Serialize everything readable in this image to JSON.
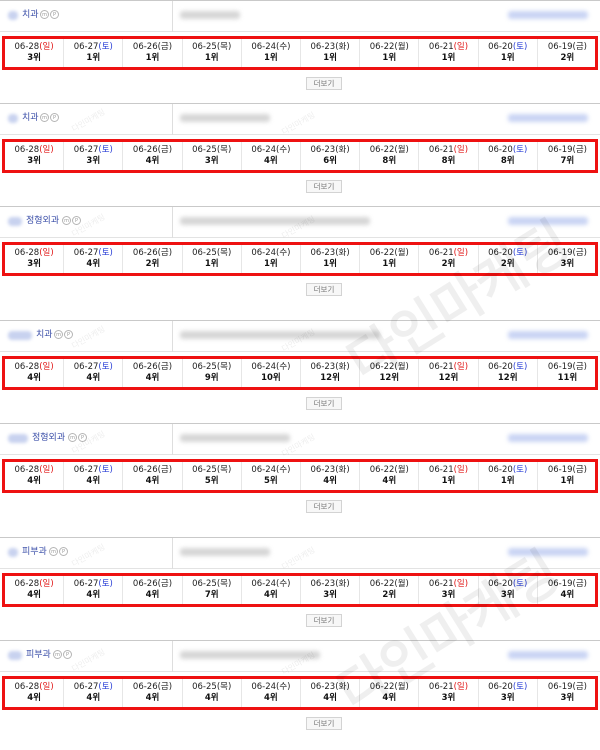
{
  "more_label": "더보기",
  "watermark": "다인마케팅",
  "blocks": [
    {
      "category": "치과",
      "dates": [
        "06-28",
        "06-27",
        "06-26",
        "06-25",
        "06-24",
        "06-23",
        "06-22",
        "06-21",
        "06-20",
        "06-19"
      ],
      "days": [
        "(일)",
        "(토)",
        "(금)",
        "(목)",
        "(수)",
        "(화)",
        "(월)",
        "(일)",
        "(토)",
        "(금)"
      ],
      "ranks": [
        "3위",
        "1위",
        "1위",
        "1위",
        "1위",
        "1위",
        "1위",
        "1위",
        "1위",
        "2위"
      ]
    },
    {
      "category": "치과",
      "dates": [
        "06-28",
        "06-27",
        "06-26",
        "06-25",
        "06-24",
        "06-23",
        "06-22",
        "06-21",
        "06-20",
        "06-19"
      ],
      "days": [
        "(일)",
        "(토)",
        "(금)",
        "(목)",
        "(수)",
        "(화)",
        "(월)",
        "(일)",
        "(토)",
        "(금)"
      ],
      "ranks": [
        "3위",
        "3위",
        "4위",
        "3위",
        "4위",
        "6위",
        "8위",
        "8위",
        "8위",
        "7위"
      ]
    },
    {
      "category": "정형외과",
      "dates": [
        "06-28",
        "06-27",
        "06-26",
        "06-25",
        "06-24",
        "06-23",
        "06-22",
        "06-21",
        "06-20",
        "06-19"
      ],
      "days": [
        "(일)",
        "(토)",
        "(금)",
        "(목)",
        "(수)",
        "(화)",
        "(월)",
        "(일)",
        "(토)",
        "(금)"
      ],
      "ranks": [
        "3위",
        "4위",
        "2위",
        "1위",
        "1위",
        "1위",
        "1위",
        "2위",
        "2위",
        "3위"
      ]
    },
    {
      "category": "치과",
      "dates": [
        "06-28",
        "06-27",
        "06-26",
        "06-25",
        "06-24",
        "06-23",
        "06-22",
        "06-21",
        "06-20",
        "06-19"
      ],
      "days": [
        "(일)",
        "(토)",
        "(금)",
        "(목)",
        "(수)",
        "(화)",
        "(월)",
        "(일)",
        "(토)",
        "(금)"
      ],
      "ranks": [
        "4위",
        "4위",
        "4위",
        "9위",
        "10위",
        "12위",
        "12위",
        "12위",
        "12위",
        "11위"
      ]
    },
    {
      "category": "정형외과",
      "dates": [
        "06-28",
        "06-27",
        "06-26",
        "06-25",
        "06-24",
        "06-23",
        "06-22",
        "06-21",
        "06-20",
        "06-19"
      ],
      "days": [
        "(일)",
        "(토)",
        "(금)",
        "(목)",
        "(수)",
        "(화)",
        "(월)",
        "(일)",
        "(토)",
        "(금)"
      ],
      "ranks": [
        "4위",
        "4위",
        "4위",
        "5위",
        "5위",
        "4위",
        "4위",
        "1위",
        "1위",
        "1위"
      ]
    },
    {
      "category": "피부과",
      "dates": [
        "06-28",
        "06-27",
        "06-26",
        "06-25",
        "06-24",
        "06-23",
        "06-22",
        "06-21",
        "06-20",
        "06-19"
      ],
      "days": [
        "(일)",
        "(토)",
        "(금)",
        "(목)",
        "(수)",
        "(화)",
        "(월)",
        "(일)",
        "(토)",
        "(금)"
      ],
      "ranks": [
        "4위",
        "4위",
        "4위",
        "7위",
        "4위",
        "3위",
        "2위",
        "3위",
        "3위",
        "4위"
      ]
    },
    {
      "category": "피부과",
      "dates": [
        "06-28",
        "06-27",
        "06-26",
        "06-25",
        "06-24",
        "06-23",
        "06-22",
        "06-21",
        "06-20",
        "06-19"
      ],
      "days": [
        "(일)",
        "(토)",
        "(금)",
        "(목)",
        "(수)",
        "(화)",
        "(월)",
        "(일)",
        "(토)",
        "(금)"
      ],
      "ranks": [
        "4위",
        "4위",
        "4위",
        "4위",
        "4위",
        "4위",
        "4위",
        "3위",
        "3위",
        "3위"
      ]
    }
  ]
}
